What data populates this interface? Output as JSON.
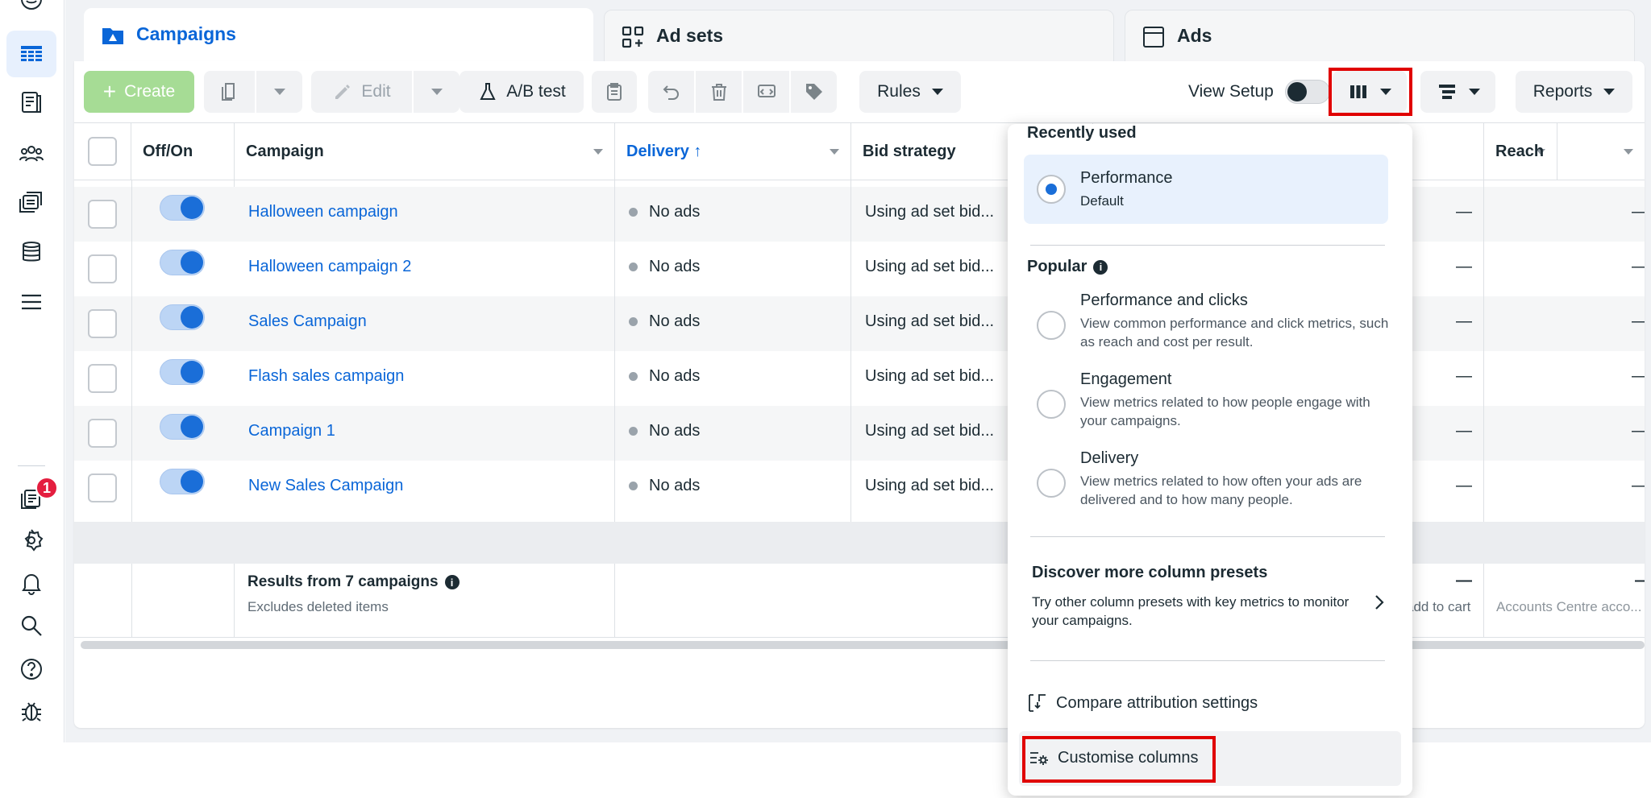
{
  "tabs": [
    {
      "label": "Campaigns",
      "icon": "folder-icon"
    },
    {
      "label": "Ad sets",
      "icon": "grid-icon"
    },
    {
      "label": "Ads",
      "icon": "ad-window-icon"
    }
  ],
  "toolbar": {
    "create_label": "Create",
    "edit_label": "Edit",
    "ab_test_label": "A/B test",
    "rules_label": "Rules",
    "view_setup_label": "View Setup",
    "reports_label": "Reports"
  },
  "table": {
    "headers": {
      "off_on": "Off/On",
      "campaign": "Campaign",
      "delivery": "Delivery ↑",
      "bid_strategy": "Bid strategy",
      "reach": "Reach"
    },
    "rows": [
      {
        "name": "Halloween campaign",
        "delivery": "No ads",
        "bid": "Using ad set bid...",
        "col_a": "—",
        "reach": "—"
      },
      {
        "name": "Halloween campaign 2",
        "delivery": "No ads",
        "bid": "Using ad set bid...",
        "col_a": "—",
        "reach": "—"
      },
      {
        "name": "Sales Campaign",
        "delivery": "No ads",
        "bid": "Using ad set bid...",
        "col_a": "—",
        "reach": "—"
      },
      {
        "name": "Flash sales campaign",
        "delivery": "No ads",
        "bid": "Using ad set bid...",
        "col_a": "—",
        "reach": "—"
      },
      {
        "name": "Campaign 1",
        "delivery": "No ads",
        "bid": "Using ad set bid...",
        "col_a": "—",
        "reach": "—"
      },
      {
        "name": "New Sales Campaign",
        "delivery": "No ads",
        "bid": "Using ad set bid...",
        "col_a": "—",
        "reach": "—"
      }
    ],
    "summary": {
      "title": "Results from 7 campaigns",
      "subtitle": "Excludes deleted items",
      "col_a_value": "—",
      "col_a_sub": "add to cart",
      "reach_value": "—",
      "reach_sub": "Accounts Centre acco..."
    }
  },
  "dropdown": {
    "recently_used": "Recently used",
    "performance": {
      "title": "Performance",
      "desc": "Default"
    },
    "popular": "Popular",
    "options": [
      {
        "title": "Performance and clicks",
        "desc": "View common performance and click metrics, such as reach and cost per result."
      },
      {
        "title": "Engagement",
        "desc": "View metrics related to how people engage with your campaigns."
      },
      {
        "title": "Delivery",
        "desc": "View metrics related to how often your ads are delivered and to how many people."
      }
    ],
    "discover_title": "Discover more column presets",
    "discover_desc": "Try other column presets with key metrics to monitor your campaigns.",
    "compare_label": "Compare attribution settings",
    "customise_label": "Customise columns"
  },
  "notifications_badge": "1",
  "colors": {
    "accent": "#0a66d8",
    "create": "#a6dc95",
    "highlight": "#e00000"
  }
}
